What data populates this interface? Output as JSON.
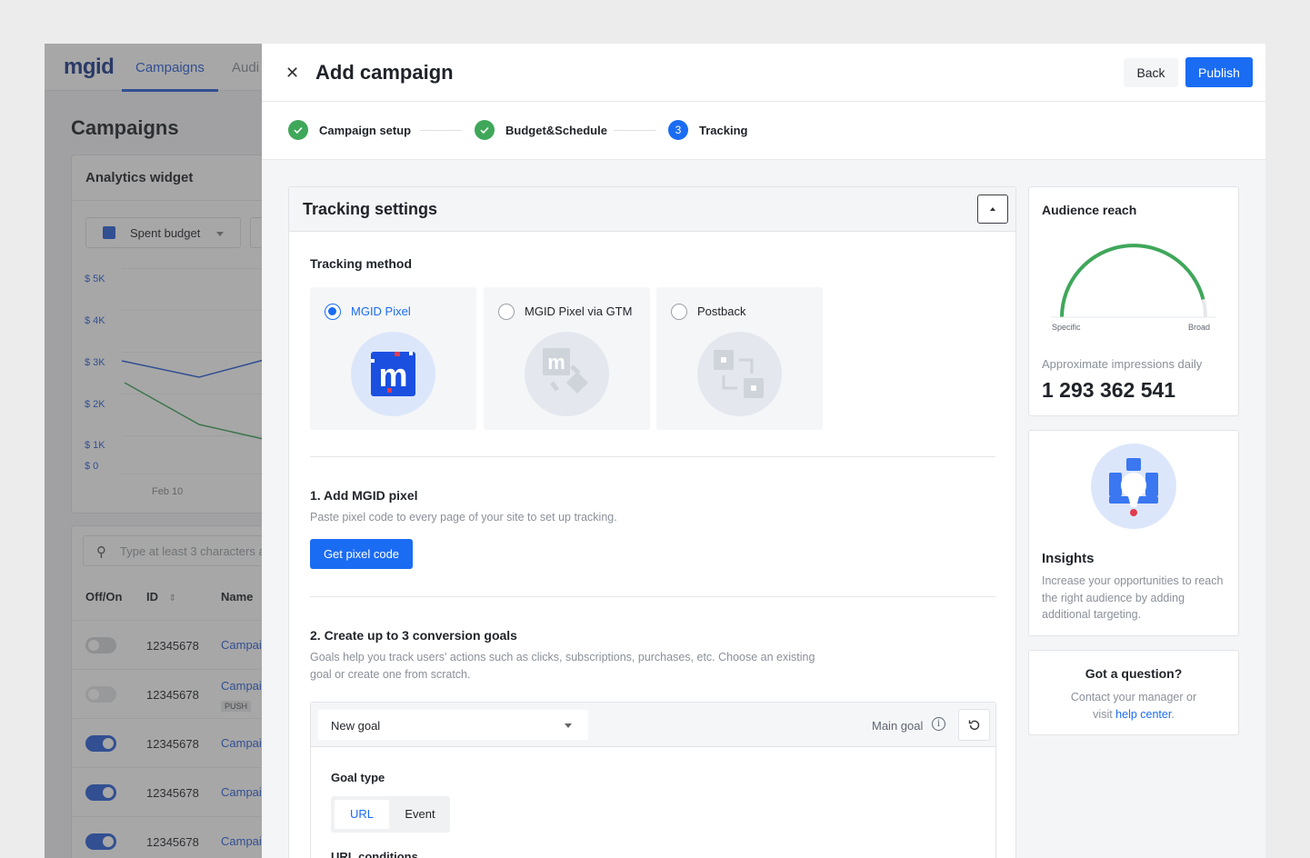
{
  "background_app": {
    "logo": "mgid",
    "nav_tabs": [
      "Campaigns",
      "Audi"
    ],
    "page_title": "Campaigns",
    "widget_title": "Analytics widget",
    "spent_select": "Spent budget",
    "y_ticks": [
      "$ 5K",
      "$ 4K",
      "$ 3K",
      "$ 2K",
      "$ 1K",
      "$ 0"
    ],
    "x_tick": "Feb 10",
    "search_placeholder": "Type at least 3 characters a",
    "columns": [
      "Off/On",
      "ID",
      "Name"
    ],
    "rows": [
      {
        "id": "12345678",
        "name": "Campai",
        "on": false,
        "badge": ""
      },
      {
        "id": "12345678",
        "name": "Campai",
        "on": false,
        "badge": "PUSH"
      },
      {
        "id": "12345678",
        "name": "Campai",
        "on": true,
        "badge": ""
      },
      {
        "id": "12345678",
        "name": "Campai",
        "on": true,
        "badge": ""
      },
      {
        "id": "12345678",
        "name": "Campai",
        "on": true,
        "badge": ""
      }
    ]
  },
  "modal": {
    "close_icon": "close-icon",
    "title": "Add campaign",
    "back_label": "Back",
    "publish_label": "Publish",
    "steps": [
      {
        "label": "Campaign setup",
        "state": "done"
      },
      {
        "label": "Budget&Schedule",
        "state": "done"
      },
      {
        "label": "Tracking",
        "state": "current",
        "number": "3"
      }
    ]
  },
  "tracking": {
    "card_title": "Tracking settings",
    "method_title": "Tracking method",
    "methods": [
      {
        "label": "MGID Pixel",
        "selected": true
      },
      {
        "label": "MGID Pixel via GTM",
        "selected": false
      },
      {
        "label": "Postback",
        "selected": false
      }
    ],
    "add_pixel_title": "1. Add MGID pixel",
    "add_pixel_desc": "Paste pixel code to every page of your site to set up tracking.",
    "get_pixel_label": "Get pixel code",
    "goals_title": "2. Create up to 3 conversion goals",
    "goals_desc_1": "Goals help you track users' actions such as clicks, subscriptions, purchases, etc. Choose an existing",
    "goals_desc_2": "goal or create one from scratch.",
    "goal_select": "New goal",
    "main_goal_label": "Main goal",
    "info_icon": "i",
    "goal_type_label": "Goal type",
    "goal_type_options": [
      "URL",
      "Event"
    ],
    "goal_type_selected": "URL",
    "url_conditions_label": "URL conditions"
  },
  "audience": {
    "title": "Audience reach",
    "gauge_level_percent": 92,
    "gauge_min_label": "Specific",
    "gauge_max_label": "Broad",
    "approx_label": "Approximate impressions daily",
    "impressions": "1 293 362 541"
  },
  "insights": {
    "title": "Insights",
    "desc": "Increase your opportunities to reach the right audience by adding additional targeting."
  },
  "question": {
    "title": "Got a question?",
    "desc_1": "Contact your manager or",
    "desc_2_prefix": "visit ",
    "link": "help center",
    "desc_2_suffix": "."
  },
  "colors": {
    "accent": "#1a6cf3",
    "done": "#3fa75a",
    "gauge_green": "#3fa75a",
    "brand_red": "#e23b4e"
  }
}
